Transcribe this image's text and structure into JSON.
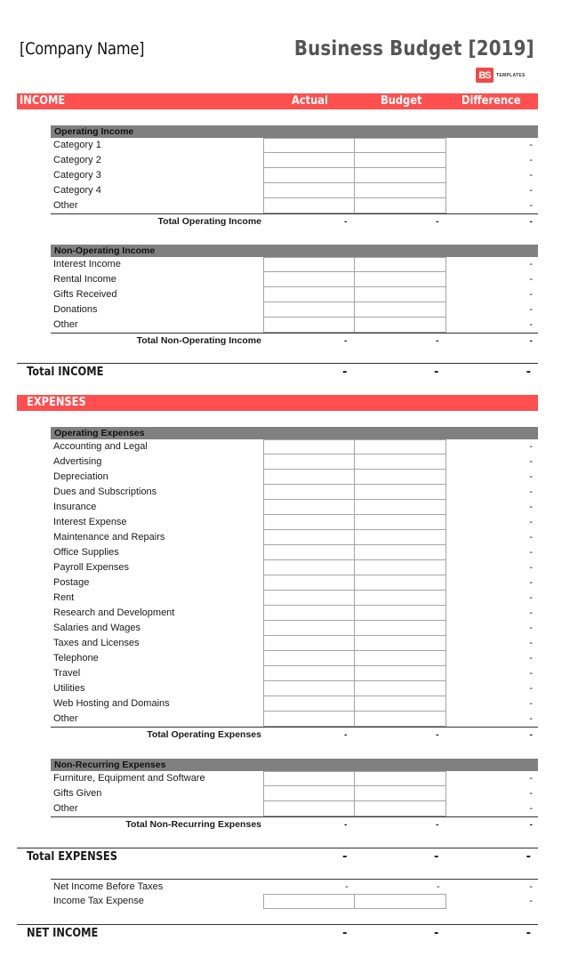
{
  "header": {
    "company_name": "[Company Name]",
    "title": "Business Budget [2019]",
    "logo_mark": "BS",
    "logo_text": "TEMPLATES"
  },
  "columns": {
    "actual": "Actual",
    "budget": "Budget",
    "difference": "Difference"
  },
  "colors": {
    "accent": "#ff4f4f",
    "group_header": "#808080",
    "title_gray": "#555555"
  },
  "income": {
    "label": "INCOME",
    "operating": {
      "title": "Operating Income",
      "rows": [
        {
          "label": "Category 1",
          "actual": "",
          "budget": "",
          "difference": "-"
        },
        {
          "label": "Category 2",
          "actual": "",
          "budget": "",
          "difference": "-"
        },
        {
          "label": "Category 3",
          "actual": "",
          "budget": "",
          "difference": "-"
        },
        {
          "label": "Category 4",
          "actual": "",
          "budget": "",
          "difference": "-"
        },
        {
          "label": "Other",
          "actual": "",
          "budget": "",
          "difference": "-"
        }
      ],
      "total": {
        "label": "Total Operating Income",
        "actual": "-",
        "budget": "-",
        "difference": "-"
      }
    },
    "non_operating": {
      "title": "Non-Operating Income",
      "rows": [
        {
          "label": "Interest Income",
          "actual": "",
          "budget": "",
          "difference": "-"
        },
        {
          "label": "Rental Income",
          "actual": "",
          "budget": "",
          "difference": "-"
        },
        {
          "label": "Gifts Received",
          "actual": "",
          "budget": "",
          "difference": "-"
        },
        {
          "label": "Donations",
          "actual": "",
          "budget": "",
          "difference": "-"
        },
        {
          "label": "Other",
          "actual": "",
          "budget": "",
          "difference": "-"
        }
      ],
      "total": {
        "label": "Total Non-Operating Income",
        "actual": "-",
        "budget": "-",
        "difference": "-"
      }
    },
    "grand_total": {
      "label": "Total INCOME",
      "actual": "-",
      "budget": "-",
      "difference": "-"
    }
  },
  "expenses": {
    "label": "EXPENSES",
    "operating": {
      "title": "Operating Expenses",
      "rows": [
        {
          "label": "Accounting and Legal",
          "actual": "",
          "budget": "",
          "difference": "-"
        },
        {
          "label": "Advertising",
          "actual": "",
          "budget": "",
          "difference": "-"
        },
        {
          "label": "Depreciation",
          "actual": "",
          "budget": "",
          "difference": "-"
        },
        {
          "label": "Dues and Subscriptions",
          "actual": "",
          "budget": "",
          "difference": "-"
        },
        {
          "label": "Insurance",
          "actual": "",
          "budget": "",
          "difference": "-"
        },
        {
          "label": "Interest Expense",
          "actual": "",
          "budget": "",
          "difference": "-"
        },
        {
          "label": "Maintenance and Repairs",
          "actual": "",
          "budget": "",
          "difference": "-"
        },
        {
          "label": "Office Supplies",
          "actual": "",
          "budget": "",
          "difference": "-"
        },
        {
          "label": "Payroll Expenses",
          "actual": "",
          "budget": "",
          "difference": "-"
        },
        {
          "label": "Postage",
          "actual": "",
          "budget": "",
          "difference": "-"
        },
        {
          "label": "Rent",
          "actual": "",
          "budget": "",
          "difference": "-"
        },
        {
          "label": "Research and Development",
          "actual": "",
          "budget": "",
          "difference": "-"
        },
        {
          "label": "Salaries and Wages",
          "actual": "",
          "budget": "",
          "difference": "-"
        },
        {
          "label": "Taxes and Licenses",
          "actual": "",
          "budget": "",
          "difference": "-"
        },
        {
          "label": "Telephone",
          "actual": "",
          "budget": "",
          "difference": "-"
        },
        {
          "label": "Travel",
          "actual": "",
          "budget": "",
          "difference": "-"
        },
        {
          "label": "Utilities",
          "actual": "",
          "budget": "",
          "difference": "-"
        },
        {
          "label": "Web Hosting and Domains",
          "actual": "",
          "budget": "",
          "difference": "-"
        },
        {
          "label": "Other",
          "actual": "",
          "budget": "",
          "difference": "-"
        }
      ],
      "total": {
        "label": "Total Operating Expenses",
        "actual": "-",
        "budget": "-",
        "difference": "-"
      }
    },
    "non_recurring": {
      "title": "Non-Recurring Expenses",
      "rows": [
        {
          "label": "Furniture, Equipment and Software",
          "actual": "",
          "budget": "",
          "difference": "-"
        },
        {
          "label": "Gifts Given",
          "actual": "",
          "budget": "",
          "difference": "-"
        },
        {
          "label": "Other",
          "actual": "",
          "budget": "",
          "difference": "-"
        }
      ],
      "total": {
        "label": "Total Non-Recurring Expenses",
        "actual": "-",
        "budget": "-",
        "difference": "-"
      }
    },
    "grand_total": {
      "label": "Total EXPENSES",
      "actual": "-",
      "budget": "-",
      "difference": "-"
    }
  },
  "summary": {
    "net_income_before_taxes": {
      "label": "Net Income Before Taxes",
      "actual": "-",
      "budget": "-",
      "difference": "-"
    },
    "income_tax_expense": {
      "label": "Income Tax Expense",
      "actual": "",
      "budget": "",
      "difference": "-"
    },
    "net_income": {
      "label": "NET INCOME",
      "actual": "-",
      "budget": "-",
      "difference": "-"
    }
  }
}
